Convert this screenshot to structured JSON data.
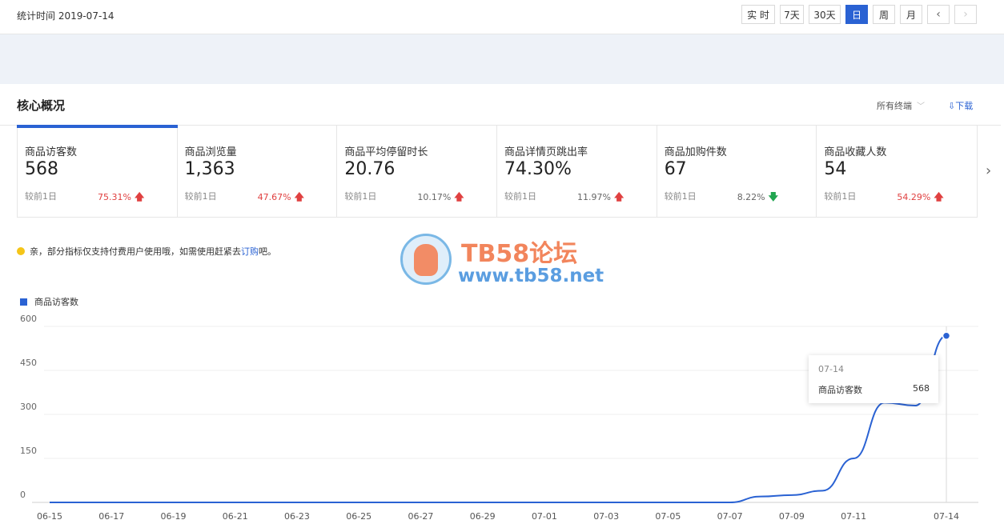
{
  "header": {
    "stat_time": "统计时间 2019-07-14",
    "ranges": [
      {
        "label": "实 时",
        "active": false
      },
      {
        "label": "7天",
        "active": false
      },
      {
        "label": "30天",
        "active": false
      },
      {
        "label": "日",
        "active": true
      },
      {
        "label": "周",
        "active": false
      },
      {
        "label": "月",
        "active": false
      }
    ],
    "prev_icon": "chevron-left-icon",
    "next_icon": "chevron-right-icon"
  },
  "panel": {
    "title": "核心概况",
    "terminal": "所有终端",
    "download": "下载"
  },
  "metrics": [
    {
      "name": "商品访客数",
      "value": "568",
      "compare": "较前1日",
      "pct": "75.31%",
      "trend": "up",
      "active": true
    },
    {
      "name": "商品浏览量",
      "value": "1,363",
      "compare": "较前1日",
      "pct": "47.67%",
      "trend": "up",
      "active": false
    },
    {
      "name": "商品平均停留时长",
      "value": "20.76",
      "compare": "较前1日",
      "pct": "10.17%",
      "trend": "up",
      "active": false
    },
    {
      "name": "商品详情页跳出率",
      "value": "74.30%",
      "compare": "较前1日",
      "pct": "11.97%",
      "trend": "up",
      "active": false
    },
    {
      "name": "商品加购件数",
      "value": "67",
      "compare": "较前1日",
      "pct": "8.22%",
      "trend": "down",
      "active": false
    },
    {
      "name": "商品收藏人数",
      "value": "54",
      "compare": "较前1日",
      "pct": "54.29%",
      "trend": "up",
      "active": false
    }
  ],
  "notice": {
    "text": "亲，部分指标仅支持付费用户使用哦，如需使用赶紧去",
    "link": "订购",
    "tail": "吧。"
  },
  "watermark": {
    "title": "TB58论坛",
    "url": "www.tb58.net"
  },
  "colors": {
    "accent": "#2a62d3",
    "up": "#e04040",
    "down": "#21a550"
  },
  "tooltip": {
    "date": "07-14",
    "label": "商品访客数",
    "value": "568"
  },
  "chart_data": {
    "type": "line",
    "x": [
      "06-15",
      "06-16",
      "06-17",
      "06-18",
      "06-19",
      "06-20",
      "06-21",
      "06-22",
      "06-23",
      "06-24",
      "06-25",
      "06-26",
      "06-27",
      "06-28",
      "06-29",
      "06-30",
      "07-01",
      "07-02",
      "07-03",
      "07-04",
      "07-05",
      "07-06",
      "07-07",
      "07-08",
      "07-09",
      "07-10",
      "07-11",
      "07-12",
      "07-13",
      "07-14"
    ],
    "x_tick_labels": [
      "06-15",
      "06-17",
      "06-19",
      "06-21",
      "06-23",
      "06-25",
      "06-27",
      "06-29",
      "07-01",
      "07-03",
      "07-05",
      "07-07",
      "07-09",
      "07-11",
      "07-14"
    ],
    "series": [
      {
        "name": "商品访客数",
        "values": [
          0,
          0,
          0,
          0,
          0,
          0,
          0,
          0,
          0,
          0,
          0,
          0,
          0,
          0,
          0,
          0,
          0,
          0,
          0,
          0,
          0,
          0,
          0,
          20,
          25,
          40,
          150,
          340,
          330,
          568
        ]
      }
    ],
    "y_ticks": [
      0,
      150,
      300,
      450,
      600
    ],
    "ylim": [
      0,
      600
    ],
    "grid": true,
    "legend": "top-left"
  }
}
